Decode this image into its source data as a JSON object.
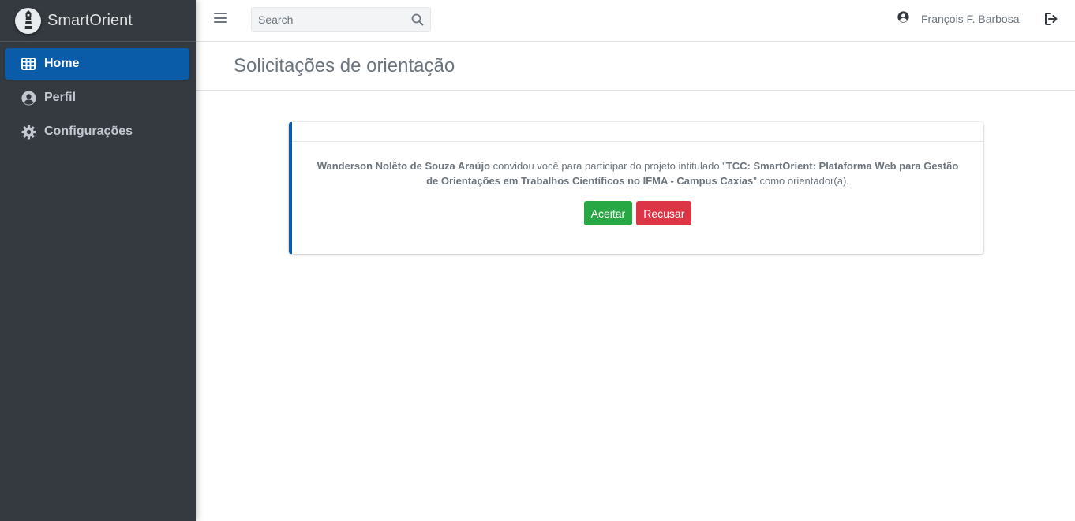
{
  "app": {
    "name": "SmartOrient",
    "logo_icon": "lighthouse-logo"
  },
  "sidebar": {
    "items": [
      {
        "label": "Home",
        "icon": "table-icon",
        "active": true
      },
      {
        "label": "Perfil",
        "icon": "user-circle-icon",
        "active": false
      },
      {
        "label": "Configurações",
        "icon": "gear-icon",
        "active": false
      }
    ]
  },
  "navbar": {
    "search_placeholder": "Search",
    "user_name": "François F. Barbosa"
  },
  "page": {
    "title": "Solicitações de orientação"
  },
  "request": {
    "requester": "Wanderson Nolêto de Souza Araújo",
    "text_invited": " convidou você para participar do projeto intitulado \"",
    "project": "TCC: SmartOrient: Plataforma Web para Gestão de Orientações em Trabalhos Científicos no IFMA - Campus Caxias",
    "text_role": "\" como orientador(a).",
    "accept_label": "Aceitar",
    "refuse_label": "Recusar"
  },
  "colors": {
    "sidebar_bg": "#343a40",
    "active_item": "#0a5ca8",
    "accept": "#28a745",
    "refuse": "#dc3545"
  }
}
